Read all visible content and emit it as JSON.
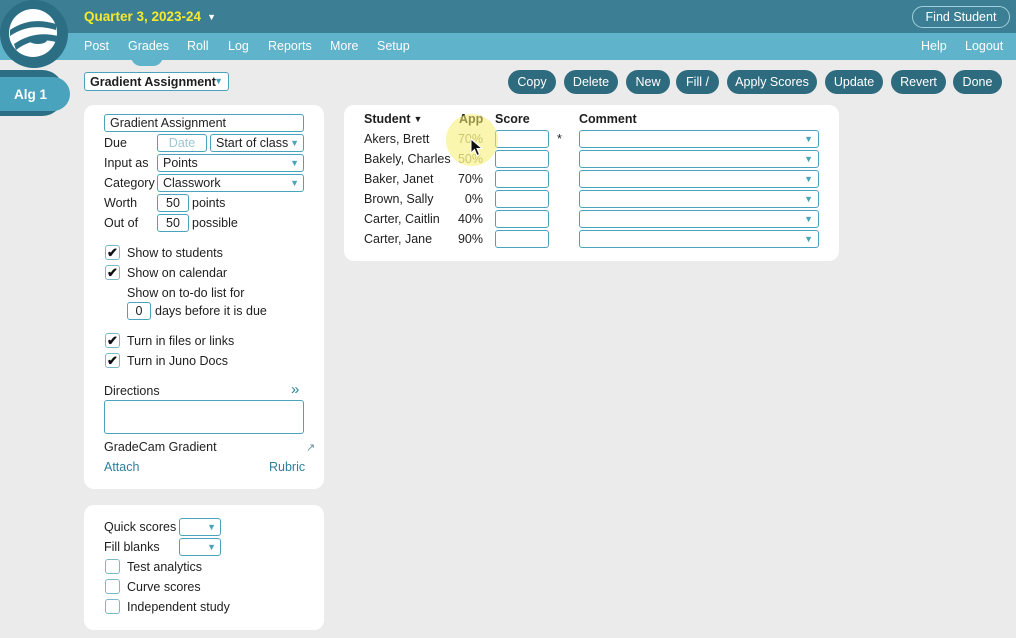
{
  "header": {
    "quarter": "Quarter 3, 2023-24",
    "find_student": "Find Student",
    "nav": [
      {
        "label": "Post"
      },
      {
        "label": "Grades"
      },
      {
        "label": "Roll"
      },
      {
        "label": "Log"
      },
      {
        "label": "Reports"
      },
      {
        "label": "More"
      },
      {
        "label": "Setup"
      }
    ],
    "right_nav": [
      {
        "label": "Help"
      },
      {
        "label": "Logout"
      }
    ]
  },
  "class_tab": "Alg 1",
  "assignment_selector": "Gradient Assignment",
  "toolbar": {
    "buttons": [
      {
        "label": "Copy"
      },
      {
        "label": "Delete"
      },
      {
        "label": "New"
      },
      {
        "label": "Fill /"
      },
      {
        "label": "Apply Scores"
      },
      {
        "label": "Update"
      },
      {
        "label": "Revert"
      },
      {
        "label": "Done"
      }
    ]
  },
  "form": {
    "name": "Gradient Assignment",
    "due_label": "Due",
    "due_date_placeholder": "Date",
    "due_time": "Start of class",
    "input_as_label": "Input as",
    "input_as": "Points",
    "category_label": "Category",
    "category": "Classwork",
    "worth_label": "Worth",
    "worth": "50",
    "worth_unit": "points",
    "outof_label": "Out of",
    "outof": "50",
    "outof_unit": "possible",
    "show_to_students": "Show to students",
    "show_on_calendar": "Show on calendar",
    "todo_label": "Show on to-do list for",
    "todo_days": "0",
    "todo_suffix": "days before it is due",
    "turn_in_files": "Turn in files or links",
    "turn_in_juno": "Turn in Juno Docs",
    "directions_label": "Directions",
    "directions_expand": "»",
    "gradecam": "GradeCam Gradient",
    "gradecam_icon": "external-link-icon",
    "attach": "Attach",
    "rubric": "Rubric"
  },
  "options": {
    "quick_scores": "Quick scores",
    "fill_blanks": "Fill blanks",
    "test_analytics": "Test analytics",
    "curve_scores": "Curve scores",
    "independent_study": "Independent study"
  },
  "table": {
    "headers": {
      "student": "Student",
      "app": "App",
      "score": "Score",
      "comment": "Comment"
    },
    "asterisk": "*",
    "rows": [
      {
        "student": "Akers, Brett",
        "app": "70%"
      },
      {
        "student": "Bakely, Charles",
        "app": "50%"
      },
      {
        "student": "Baker, Janet",
        "app": "70%"
      },
      {
        "student": "Brown, Sally",
        "app": "0%"
      },
      {
        "student": "Carter, Caitlin",
        "app": "40%"
      },
      {
        "student": "Carter, Jane",
        "app": "90%"
      }
    ]
  },
  "colors": {
    "header_dark": "#3c7f94",
    "header_light": "#5fb3cb",
    "accent_yellow": "#f5ea2d",
    "button": "#2e6b7e",
    "link": "#2e7f9a"
  }
}
